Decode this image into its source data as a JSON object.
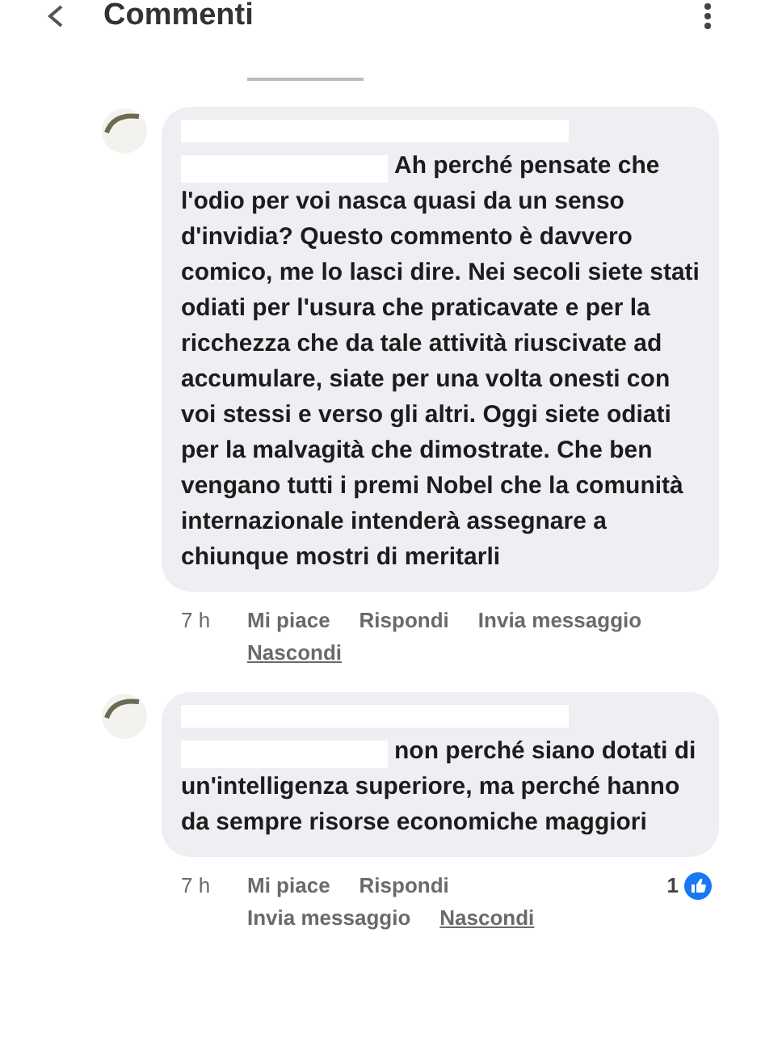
{
  "header": {
    "title": "Commenti"
  },
  "comments": [
    {
      "text": "Ah perché pensate che l'odio per voi nasca quasi da un senso d'invidia? Questo commento è davvero comico, me lo lasci dire. Nei secoli siete stati odiati per l'usura che praticavate e per la ricchezza che da tale attività riuscivate ad accumulare, siate per una volta onesti con voi stessi e verso gli altri. Oggi siete odiati per la malvagità che dimostrate. Che ben vengano tutti i premi Nobel che la comunità internazionale intenderà assegnare a chiunque mostri di meritarli",
      "time": "7 h",
      "actions": [
        {
          "label": "Mi piace",
          "kind": "action"
        },
        {
          "label": "Rispondi",
          "kind": "action"
        },
        {
          "label": "Invia messaggio",
          "kind": "action"
        },
        {
          "label": "Nascondi",
          "kind": "hide"
        }
      ]
    },
    {
      "text": "non perché siano dotati di un'intelligenza superiore,  ma perché hanno da sempre risorse economiche maggiori",
      "time": "7 h",
      "actions": [
        {
          "label": "Mi piace",
          "kind": "action"
        },
        {
          "label": "Rispondi",
          "kind": "action"
        },
        {
          "label": "Invia messaggio",
          "kind": "action"
        },
        {
          "label": "Nascondi",
          "kind": "hide"
        }
      ],
      "likes": "1"
    }
  ]
}
